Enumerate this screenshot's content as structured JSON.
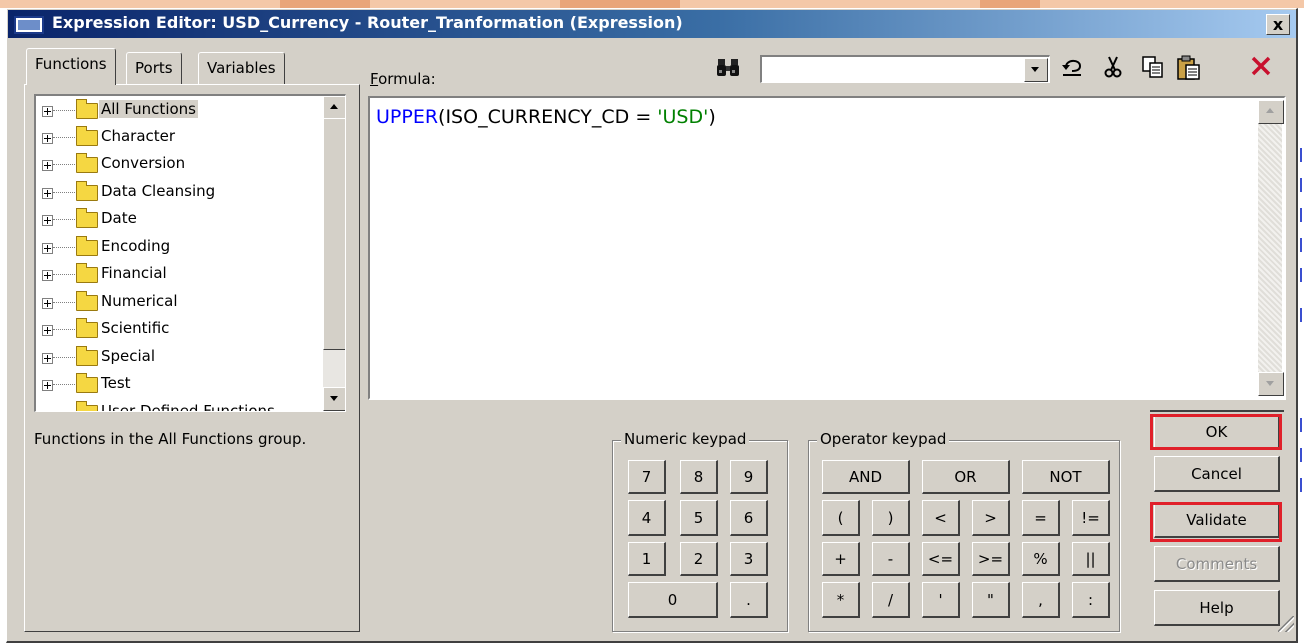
{
  "window": {
    "title": "Expression Editor: USD_Currency - Router_Tranformation (Expression)",
    "close": "x"
  },
  "tabs": [
    "Functions",
    "Ports",
    "Variables"
  ],
  "tree": [
    "All Functions",
    "Character",
    "Conversion",
    "Data Cleansing",
    "Date",
    "Encoding",
    "Financial",
    "Numerical",
    "Scientific",
    "Special",
    "Test",
    "User Defined Functions"
  ],
  "tree_selected": "All Functions",
  "description": "Functions in the All Functions group.",
  "formula": {
    "label": "Formula:",
    "fn": "UPPER",
    "mid": "(ISO_CURRENCY_CD = ",
    "str": "'USD'",
    "end": ")"
  },
  "search": {
    "value": ""
  },
  "numeric_keypad": {
    "title": "Numeric keypad",
    "keys": [
      "7",
      "8",
      "9",
      "4",
      "5",
      "6",
      "1",
      "2",
      "3",
      "0",
      "."
    ]
  },
  "operator_keypad": {
    "title": "Operator keypad",
    "keys": [
      "AND",
      "OR",
      "NOT",
      "(",
      ")",
      "<",
      ">",
      "=",
      "!=",
      "+",
      "-",
      "<=",
      ">=",
      "%",
      "||",
      "*",
      "/",
      "'",
      "\"",
      ",",
      ":"
    ]
  },
  "buttons": {
    "ok": "OK",
    "cancel": "Cancel",
    "validate": "Validate",
    "comments": "Comments",
    "help": "Help"
  }
}
